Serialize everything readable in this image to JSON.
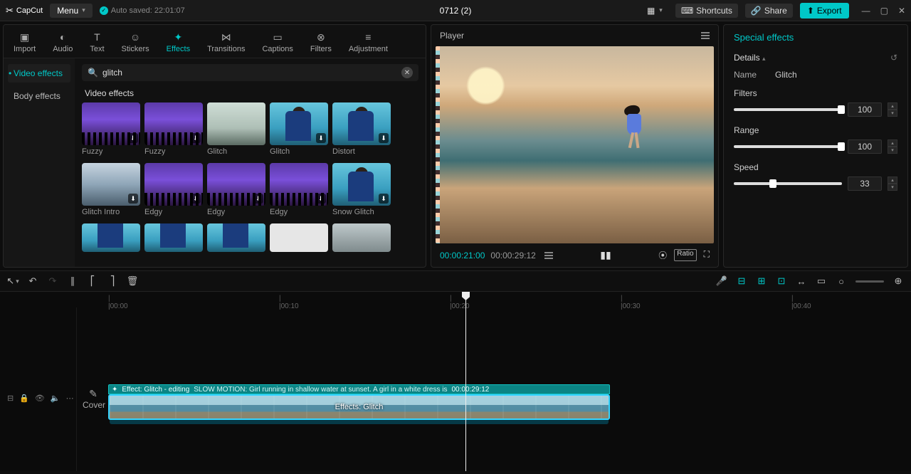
{
  "titlebar": {
    "app": "CapCut",
    "menu": "Menu",
    "autosave": "Auto saved: 22:01:07",
    "project": "0712 (2)",
    "shortcuts": "Shortcuts",
    "share": "Share",
    "export": "Export"
  },
  "tabs": {
    "import": "Import",
    "audio": "Audio",
    "text": "Text",
    "stickers": "Stickers",
    "effects": "Effects",
    "transitions": "Transitions",
    "captions": "Captions",
    "filters": "Filters",
    "adjustment": "Adjustment"
  },
  "sidebar": {
    "video": "Video effects",
    "body": "Body effects"
  },
  "search": {
    "placeholder": "",
    "value": "glitch"
  },
  "section": "Video effects",
  "grid": {
    "items": [
      {
        "label": "Fuzzy",
        "style": "concert",
        "dl": true
      },
      {
        "label": "Fuzzy",
        "style": "concert",
        "dl": true
      },
      {
        "label": "Glitch",
        "style": "car",
        "dl": false
      },
      {
        "label": "Glitch",
        "style": "person",
        "dl": true
      },
      {
        "label": "Distort",
        "style": "person",
        "dl": true
      },
      {
        "label": "Glitch Intro",
        "style": "city",
        "dl": true
      },
      {
        "label": "Edgy",
        "style": "concert",
        "dl": true
      },
      {
        "label": "Edgy",
        "style": "concert",
        "dl": true
      },
      {
        "label": "Edgy",
        "style": "concert",
        "dl": true
      },
      {
        "label": "Snow Glitch",
        "style": "person",
        "dl": true
      }
    ],
    "partial": [
      {
        "style": "person"
      },
      {
        "style": "person"
      },
      {
        "style": "person"
      },
      {
        "style": "white"
      },
      {
        "style": "snow"
      }
    ]
  },
  "player": {
    "title": "Player",
    "current": "00:00:21:00",
    "total": "00:00:29:12",
    "ratio": "Ratio"
  },
  "inspector": {
    "title": "Special effects",
    "details": "Details",
    "name_label": "Name",
    "name_value": "Glitch",
    "filters_label": "Filters",
    "filters_value": "100",
    "range_label": "Range",
    "range_value": "100",
    "speed_label": "Speed",
    "speed_value": "33"
  },
  "ruler": {
    "t0": "|00:00",
    "t10": "|00:10",
    "t20": "|00:20",
    "t30": "|00:30",
    "t40": "|00:40"
  },
  "clip": {
    "effect_label": "Effect: Glitch - editing",
    "desc": "SLOW MOTION: Girl running in shallow water at sunset. A girl in a white dress is",
    "dur": "00:00:29:12",
    "center": "Effects:  Glitch"
  },
  "cover": "Cover"
}
